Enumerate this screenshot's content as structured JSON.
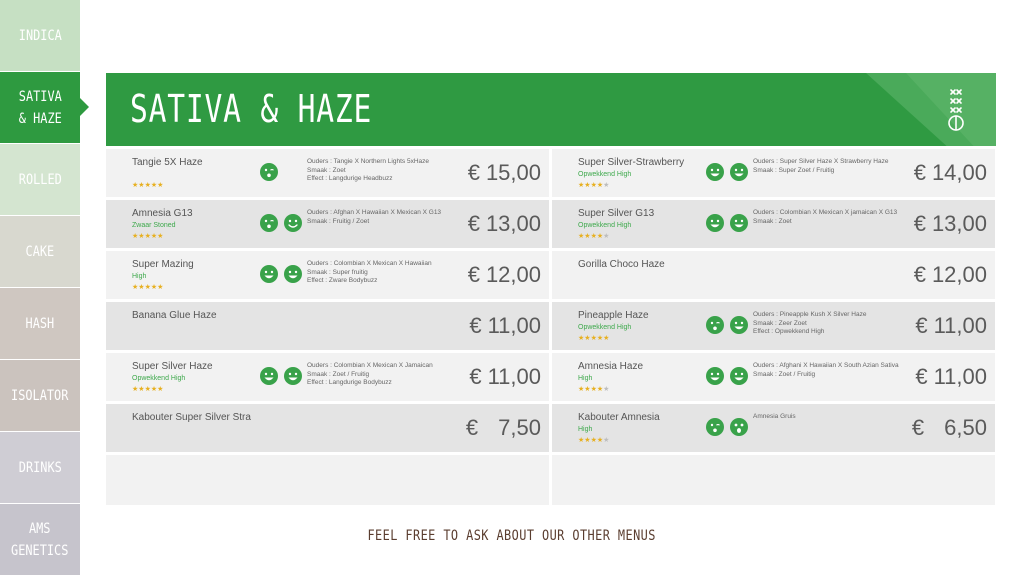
{
  "sidebar": {
    "items": [
      {
        "label": "INDICA",
        "color": "#c6e0c3"
      },
      {
        "label": "SATIVA\n& HAZE",
        "color": "#2e9a40",
        "active": true
      },
      {
        "label": "ROLLED",
        "color": "#d4e5d0"
      },
      {
        "label": "CAKE",
        "color": "#d8d8cf"
      },
      {
        "label": "HASH",
        "color": "#cfc7c1"
      },
      {
        "label": "ISOLATOR",
        "color": "#cbc3be"
      },
      {
        "label": "DRINKS",
        "color": "#cfcdd4"
      },
      {
        "label": "AMS\nGENETICS",
        "color": "#c6c4cc"
      }
    ]
  },
  "header": {
    "title": "SATIVA & HAZE",
    "logo_icon": "ams-logo-icon"
  },
  "currency": "€",
  "menu": {
    "left": [
      {
        "name": "Tangie 5X Haze",
        "effect": "",
        "stars": 5,
        "faces": [
          "wink"
        ],
        "desc": [
          "Ouders : Tangie X Northern Lights 5xHaze",
          "Smaak : Zoet",
          "Effect : Langdurige Headbuzz"
        ],
        "price": "15,00",
        "shade": "light"
      },
      {
        "name": "Amnesia G13",
        "effect": "Zwaar Stoned",
        "stars": 5,
        "faces": [
          "wink",
          "smile"
        ],
        "desc": [
          "Ouders : Afghan X Hawaiian X Mexican X G13",
          "Smaak : Fruitig / Zoet"
        ],
        "price": "13,00",
        "shade": "dark"
      },
      {
        "name": "Super Mazing",
        "effect": "High",
        "stars": 5,
        "faces": [
          "grin",
          "grin"
        ],
        "desc": [
          "Ouders : Colombian X Mexican X Hawaiian",
          "Smaak : Super fruitig",
          "Effect : Zware Bodybuzz"
        ],
        "price": "12,00",
        "shade": "light"
      },
      {
        "name": "Banana Glue Haze",
        "effect": "",
        "stars": 0,
        "faces": [],
        "desc": [],
        "price": "11,00",
        "shade": "dark"
      },
      {
        "name": "Super Silver Haze",
        "effect": "Opwekkend High",
        "stars": 5,
        "faces": [
          "grin",
          "grin"
        ],
        "desc": [
          "Ouders : Colombian X Mexican X Jamaican",
          "Smaak : Zoet / Fruitig",
          "Effect : Langdurige Bodybuzz"
        ],
        "price": "11,00",
        "shade": "light"
      },
      {
        "name": "Kabouter Super Silver Stra",
        "effect": "",
        "stars": 0,
        "faces": [],
        "desc": [],
        "price": "7,50",
        "shade": "dark",
        "padded": true
      }
    ],
    "right": [
      {
        "name": "Super Silver-Strawberry",
        "effect": "Opwekkend High",
        "stars": 4,
        "faces": [
          "grin",
          "grin"
        ],
        "desc": [
          "Ouders : Super Silver Haze X Strawberry Haze",
          "Smaak : Super Zoet / Fruitig"
        ],
        "price": "14,00",
        "shade": "light"
      },
      {
        "name": "Super Silver G13",
        "effect": "Opwekkend High",
        "stars": 4,
        "faces": [
          "grin",
          "grin"
        ],
        "desc": [
          "Ouders : Colombian X Mexican X jamaican X G13",
          "Smaak : Zoet"
        ],
        "price": "13,00",
        "shade": "dark"
      },
      {
        "name": "Gorilla Choco Haze",
        "effect": "",
        "stars": 0,
        "faces": [],
        "desc": [],
        "price": "12,00",
        "shade": "light"
      },
      {
        "name": "Pineapple Haze",
        "effect": "Opwekkend High",
        "stars": 5,
        "faces": [
          "wink",
          "grin"
        ],
        "desc": [
          "Ouders : Pineapple Kush X Silver Haze",
          "Smaak : Zeer Zoet",
          "Effect : Opwekkend High"
        ],
        "price": "11,00",
        "shade": "dark"
      },
      {
        "name": "Amnesia Haze",
        "effect": "High",
        "stars": 4,
        "faces": [
          "grin",
          "grin"
        ],
        "desc": [
          "Ouders : Afghani X Hawaiian X South Azian Sativa",
          "Smaak : Zoet / Fruitig"
        ],
        "price": "11,00",
        "shade": "light"
      },
      {
        "name": "Kabouter Amnesia",
        "effect": "High",
        "stars": 4,
        "faces": [
          "wink",
          "surprised"
        ],
        "desc": [
          "Amnesia Gruis"
        ],
        "price": "6,50",
        "shade": "dark",
        "padded": true
      }
    ]
  },
  "footer": {
    "text": "FEEL FREE TO ASK ABOUT OUR OTHER MENUS"
  },
  "colors": {
    "accent_green": "#2f9a42",
    "face_green": "#39a24a",
    "star_gold": "#e7b021",
    "footer_brown": "#5a3d2f"
  }
}
